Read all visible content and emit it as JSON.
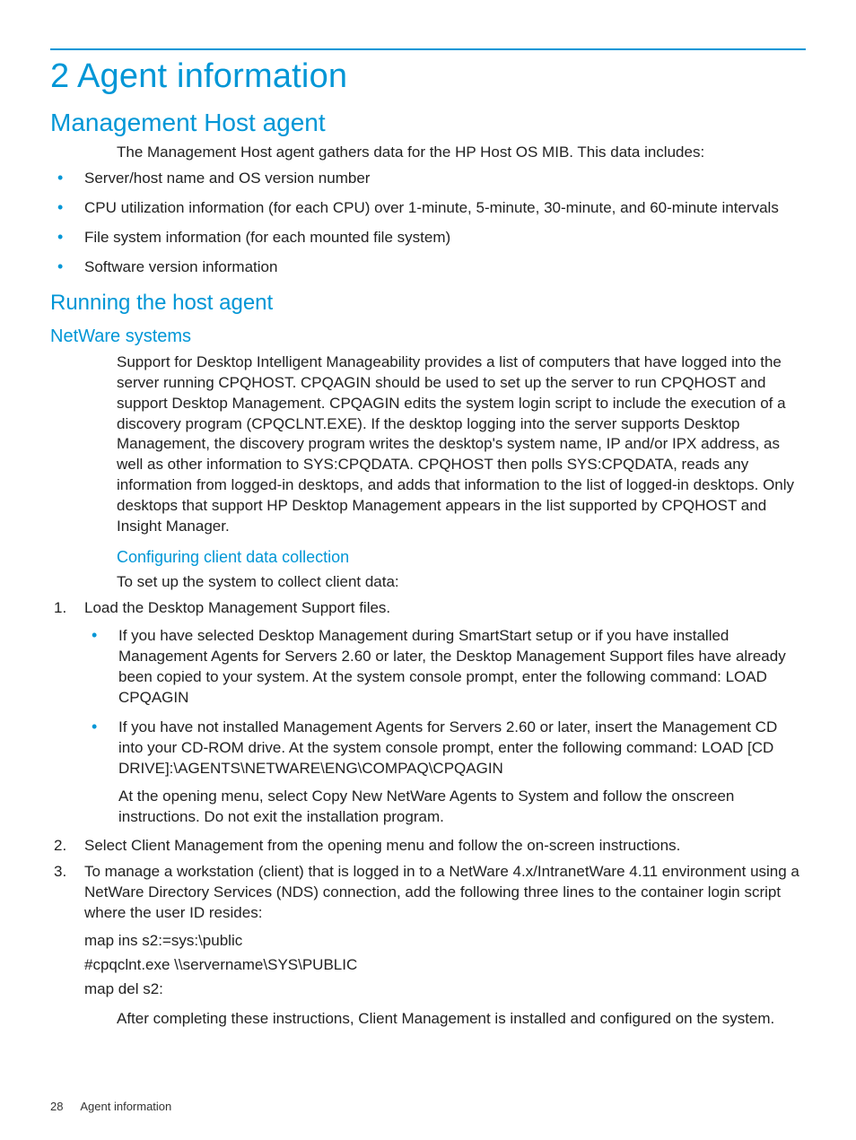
{
  "title": "2 Agent information",
  "sections": {
    "mgmt_host": {
      "heading": "Management Host agent",
      "intro": "The Management Host agent gathers data for the HP Host OS MIB. This data includes:",
      "bullets": [
        "Server/host name and OS version number",
        "CPU utilization information (for each CPU) over 1-minute, 5-minute, 30-minute, and 60-minute intervals",
        "File system information (for each mounted file system)",
        "Software version information"
      ]
    },
    "running": {
      "heading": "Running the host agent",
      "netware_heading": "NetWare systems",
      "netware_para": "Support for Desktop Intelligent Manageability provides a list of computers that have logged into the server running CPQHOST. CPQAGIN should be used to set up the server to run CPQHOST and support Desktop Management. CPQAGIN edits the system login script to include the execution of a discovery program (CPQCLNT.EXE). If the desktop logging into the server supports Desktop Management, the discovery program writes the desktop's system name, IP and/or IPX address, as well as other information to SYS:CPQDATA. CPQHOST then polls SYS:CPQDATA, reads any information from logged-in desktops, and adds that information to the list of logged-in desktops. Only desktops that support HP Desktop Management appears in the list supported by CPQHOST and Insight Manager.",
      "config_heading": "Configuring client data collection",
      "config_intro": "To set up the system to collect client data:",
      "steps": {
        "s1": "Load the Desktop Management Support files.",
        "s1_sub": [
          "If you have selected Desktop Management during SmartStart setup or if you have installed Management Agents for Servers 2.60 or later, the Desktop Management Support files have already been copied to your system. At the system console prompt, enter the following command: LOAD CPQAGIN",
          "If you have not installed Management Agents for Servers 2.60 or later, insert the Management CD into your CD-ROM drive. At the system console prompt, enter the following command: LOAD [CD DRIVE]:\\AGENTS\\NETWARE\\ENG\\COMPAQ\\CPQAGIN"
        ],
        "s1_sub2_extra": "At the opening menu, select Copy New NetWare Agents to System and follow the onscreen instructions. Do not exit the installation program.",
        "s2": "Select Client Management from the opening menu and follow the on-screen instructions.",
        "s3": "To manage a workstation (client) that is logged in to a NetWare 4.x/IntranetWare 4.11 environment using a NetWare Directory Services (NDS) connection, add the following three lines to the container login script where the user ID resides:",
        "s3_lines": [
          "map ins s2:=sys:\\public",
          "#cpqclnt.exe \\\\servername\\SYS\\PUBLIC",
          "map del s2:"
        ]
      },
      "closing": "After completing these instructions, Client Management is installed and configured on the system."
    }
  },
  "footer": {
    "page_number": "28",
    "chapter": "Agent information"
  }
}
